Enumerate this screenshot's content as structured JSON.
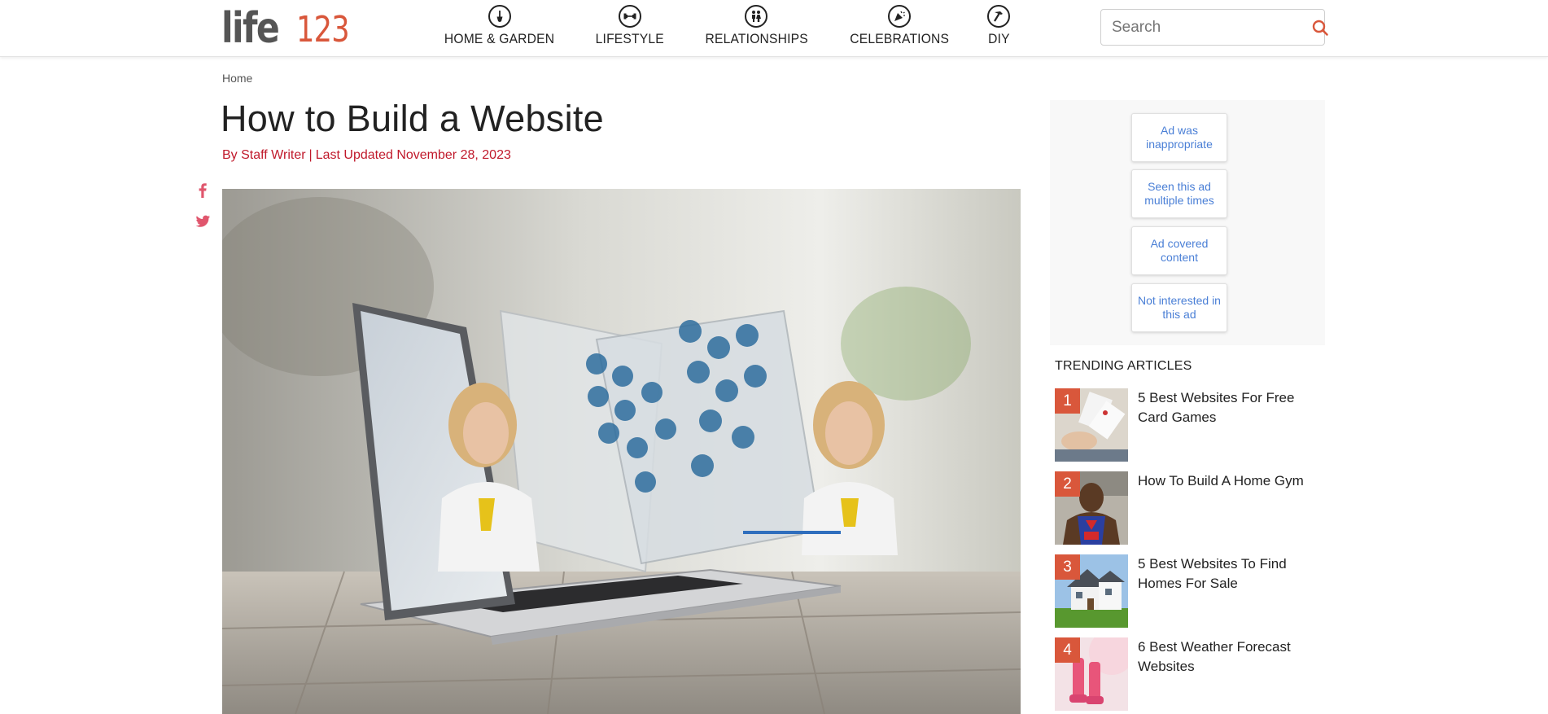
{
  "header": {
    "logo_text": "life",
    "logo_number": "123",
    "nav": [
      {
        "label": "HOME & GARDEN",
        "icon": "shovel-icon"
      },
      {
        "label": "LIFESTYLE",
        "icon": "dumbbell-icon"
      },
      {
        "label": "RELATIONSHIPS",
        "icon": "couple-icon"
      },
      {
        "label": "CELEBRATIONS",
        "icon": "party-horn-icon"
      },
      {
        "label": "DIY",
        "icon": "hammer-icon"
      }
    ],
    "search_placeholder": "Search"
  },
  "breadcrumb": {
    "home": "Home"
  },
  "article": {
    "title": "How to Build a Website",
    "byline_author": "By Staff Writer",
    "byline_separator": "|",
    "byline_updated": "Last Updated November 28, 2023"
  },
  "social": [
    "facebook-icon",
    "twitter-icon"
  ],
  "ad": {
    "options": [
      "Ad was inappropriate",
      "Seen this ad multiple times",
      "Ad covered content",
      "Not interested in this ad"
    ]
  },
  "trending": {
    "heading": "TRENDING ARTICLES",
    "items": [
      {
        "num": "1",
        "title": "5 Best Websites For Free Card Games"
      },
      {
        "num": "2",
        "title": "How To Build A Home Gym"
      },
      {
        "num": "3",
        "title": "5 Best Websites To Find Homes For Sale"
      },
      {
        "num": "4",
        "title": "6 Best Weather Forecast Websites"
      }
    ]
  },
  "colors": {
    "brand_orange": "#d9573b",
    "byline_red": "#c0192b",
    "ad_link_blue": "#4a7fd6"
  }
}
